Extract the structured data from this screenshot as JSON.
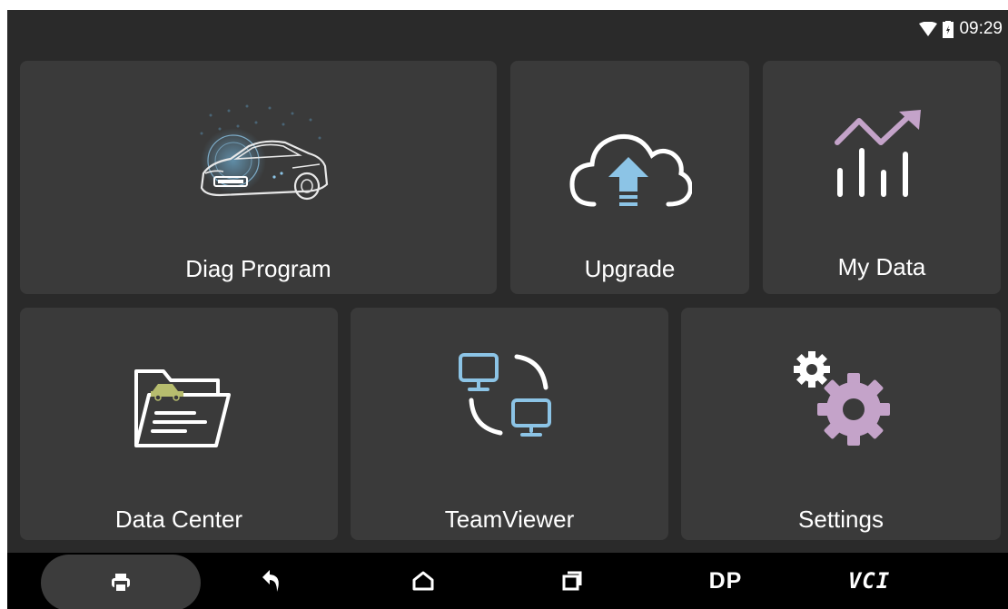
{
  "status_bar": {
    "time": "09:29",
    "icons": [
      "wifi-icon",
      "battery-charging-icon"
    ]
  },
  "tiles": [
    {
      "id": "diag-program",
      "label": "Diag Program",
      "icon": "car-icon"
    },
    {
      "id": "upgrade",
      "label": "Upgrade",
      "icon": "cloud-upload-icon"
    },
    {
      "id": "my-data",
      "label": "My Data",
      "icon": "chart-trend-icon"
    },
    {
      "id": "data-center",
      "label": "Data Center",
      "icon": "folder-car-icon"
    },
    {
      "id": "teamviewer",
      "label": "TeamViewer",
      "icon": "remote-monitors-icon"
    },
    {
      "id": "settings",
      "label": "Settings",
      "icon": "gears-icon"
    }
  ],
  "nav_bar": {
    "items": [
      {
        "id": "print",
        "icon": "print-icon"
      },
      {
        "id": "back",
        "icon": "back-icon"
      },
      {
        "id": "home",
        "icon": "home-icon"
      },
      {
        "id": "recents",
        "icon": "recents-icon"
      },
      {
        "id": "dp",
        "label": "DP"
      },
      {
        "id": "vci",
        "label": "VCI"
      }
    ]
  },
  "colors": {
    "screen_bg": "#2a2a2a",
    "tile_bg": "#3a3a3a",
    "nav_bg": "#000000",
    "accent_blue": "#8cc4e6",
    "accent_purple": "#c4a3c9",
    "text": "#ffffff"
  }
}
